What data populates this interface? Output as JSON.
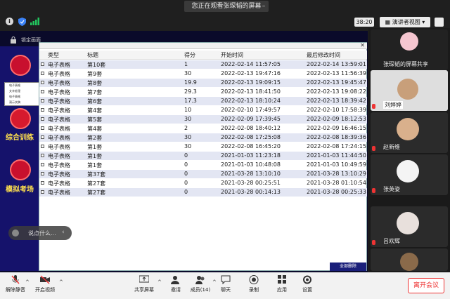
{
  "share_banner": "您正在观看张琛韬的屏幕",
  "timer": "38:20",
  "view_button": "演讲者视图",
  "lock_label": "锁定画面",
  "left_nav": {
    "items": [
      {
        "label": ""
      },
      {
        "label": "综合训练"
      },
      {
        "label": "模拟考场"
      }
    ],
    "popup": [
      "电子表格",
      "文字处理",
      "电子表格",
      "演示文稿"
    ]
  },
  "table": {
    "headers": [
      "类型",
      "标题",
      "得分",
      "开始时间",
      "最后修改时间"
    ],
    "rows": [
      [
        "电子表格",
        "第10套",
        "1",
        "2022-02-14 11:57:05",
        "2022-02-14 13:59:01"
      ],
      [
        "电子表格",
        "第9套",
        "30",
        "2022-02-13 19:47:16",
        "2022-02-13 11:56:39"
      ],
      [
        "电子表格",
        "第8套",
        "19.9",
        "2022-02-13 19:09:15",
        "2022-02-13 19:45:47"
      ],
      [
        "电子表格",
        "第7套",
        "29.3",
        "2022-02-13 18:41:50",
        "2022-02-13 19:08:22"
      ],
      [
        "电子表格",
        "第6套",
        "17.3",
        "2022-02-13 18:10:24",
        "2022-02-13 18:39:42"
      ],
      [
        "电子表格",
        "第4套",
        "10",
        "2022-02-10 17:49:57",
        "2022-02-10 17:58:39"
      ],
      [
        "电子表格",
        "第5套",
        "30",
        "2022-02-09 17:39:45",
        "2022-02-09 18:12:53"
      ],
      [
        "电子表格",
        "第4套",
        "2",
        "2022-02-08 18:40:12",
        "2022-02-09 16:46:15"
      ],
      [
        "电子表格",
        "第2套",
        "30",
        "2022-02-08 17:25:08",
        "2022-02-08 18:39:36"
      ],
      [
        "电子表格",
        "第1套",
        "30",
        "2022-02-08 16:45:20",
        "2022-02-08 17:24:15"
      ],
      [
        "电子表格",
        "第1套",
        "0",
        "2021-01-03 11:23:18",
        "2021-01-03 11:44:50"
      ],
      [
        "电子表格",
        "第1套",
        "0",
        "2021-01-03 10:48:08",
        "2021-01-03 10:49:59"
      ],
      [
        "电子表格",
        "第37套",
        "0",
        "2021-03-28 13:10:10",
        "2021-03-28 13:10:29"
      ],
      [
        "电子表格",
        "第27套",
        "0",
        "2021-03-28 00:25:51",
        "2021-03-28 01:10:54"
      ],
      [
        "电子表格",
        "第27套",
        "0",
        "2021-03-28 00:14:13",
        "2021-03-28 00:25:33"
      ]
    ],
    "bottom_button": "全部删除"
  },
  "chat_placeholder": "说点什么...",
  "participants": [
    {
      "name": "张琛韬的屏幕共享"
    },
    {
      "name": "刘婷婷"
    },
    {
      "name": "赵新维"
    },
    {
      "name": "张英姿"
    },
    {
      "name": "吕欢辉"
    }
  ],
  "toolbar": {
    "mute": "解除静音",
    "video": "开启视频",
    "share": "共享屏幕",
    "invite": "邀请",
    "members": "成员(14)",
    "chat": "聊天",
    "record": "录制",
    "apps": "应用",
    "settings": "设置",
    "leave": "离开会议"
  },
  "colors": {
    "nav_bg": "#15126b",
    "accent_red": "#e33333",
    "row_alt": "#e3e6f3"
  }
}
